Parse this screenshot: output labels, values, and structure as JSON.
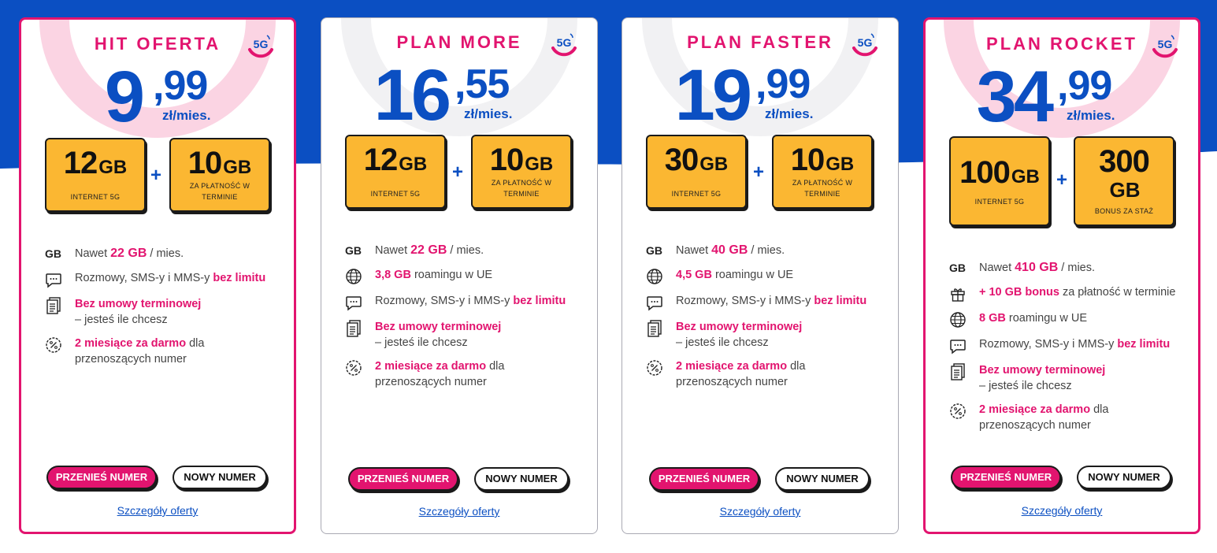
{
  "colors": {
    "accent_pink": "#e2146f",
    "brand_blue": "#0b4fc2",
    "tile_orange": "#fbb732"
  },
  "cards": [
    {
      "title": "HIT OFERTA",
      "price_int": "9",
      "price_dec": "99",
      "price_unit": "zł/mies.",
      "tiles": [
        {
          "num": "12",
          "gb": "GB",
          "desc": "INTERNET 5G"
        },
        {
          "num": "10",
          "gb": "GB",
          "desc": "ZA PŁATNOŚĆ W TERMINIE"
        }
      ],
      "features": {
        "data_a": "Nawet ",
        "data_b": "22 GB",
        "data_c": " / mies.",
        "calls_a": "Rozmowy, SMS-y i MMS-y ",
        "calls_b": "bez limitu",
        "contract_a": "Bez umowy terminowej",
        "contract_b": "– jesteś ile chcesz",
        "promo_a": "2 miesiące za darmo",
        "promo_b": " dla przenoszących numer"
      },
      "btn_primary": "PRZENIEŚ NUMER",
      "btn_secondary": "NOWY NUMER",
      "link": "Szczegóły oferty"
    },
    {
      "title": "PLAN MORE",
      "price_int": "16",
      "price_dec": "55",
      "price_unit": "zł/mies.",
      "tiles": [
        {
          "num": "12",
          "gb": "GB",
          "desc": "INTERNET 5G"
        },
        {
          "num": "10",
          "gb": "GB",
          "desc": "ZA PŁATNOŚĆ W TERMINIE"
        }
      ],
      "features": {
        "data_a": "Nawet ",
        "data_b": "22 GB",
        "data_c": " / mies.",
        "roam_a": "3,8 GB",
        "roam_b": " roamingu w UE",
        "calls_a": "Rozmowy, SMS-y i MMS-y ",
        "calls_b": "bez limitu",
        "contract_a": "Bez umowy terminowej",
        "contract_b": "– jesteś ile chcesz",
        "promo_a": "2 miesiące za darmo",
        "promo_b": " dla przenoszących numer"
      },
      "btn_primary": "PRZENIEŚ NUMER",
      "btn_secondary": "NOWY NUMER",
      "link": "Szczegóły oferty"
    },
    {
      "title": "PLAN FASTER",
      "price_int": "19",
      "price_dec": "99",
      "price_unit": "zł/mies.",
      "tiles": [
        {
          "num": "30",
          "gb": "GB",
          "desc": "INTERNET 5G"
        },
        {
          "num": "10",
          "gb": "GB",
          "desc": "ZA PŁATNOŚĆ W TERMINIE"
        }
      ],
      "features": {
        "data_a": "Nawet ",
        "data_b": "40 GB",
        "data_c": " / mies.",
        "roam_a": "4,5 GB",
        "roam_b": " roamingu w UE",
        "calls_a": "Rozmowy, SMS-y i MMS-y ",
        "calls_b": "bez limitu",
        "contract_a": "Bez umowy terminowej",
        "contract_b": "– jesteś ile chcesz",
        "promo_a": "2 miesiące za darmo",
        "promo_b": " dla przenoszących numer"
      },
      "btn_primary": "PRZENIEŚ NUMER",
      "btn_secondary": "NOWY NUMER",
      "link": "Szczegóły oferty"
    },
    {
      "title": "PLAN ROCKET",
      "price_int": "34",
      "price_dec": "99",
      "price_unit": "zł/mies.",
      "tiles": [
        {
          "num": "100",
          "gb": "GB",
          "desc": "INTERNET 5G"
        },
        {
          "num": "300",
          "gb": "GB",
          "desc": "BONUS ZA STAŻ"
        }
      ],
      "features": {
        "data_a": "Nawet ",
        "data_b": "410 GB",
        "data_c": " / mies.",
        "bonus_a": "+ 10 GB bonus",
        "bonus_b": " za płatność w terminie",
        "roam_a": "8 GB",
        "roam_b": " roamingu w UE",
        "calls_a": "Rozmowy, SMS-y i MMS-y ",
        "calls_b": "bez limitu",
        "contract_a": "Bez umowy terminowej",
        "contract_b": "– jesteś ile chcesz",
        "promo_a": "2 miesiące za darmo",
        "promo_b": " dla przenoszących numer"
      },
      "btn_primary": "PRZENIEŚ NUMER",
      "btn_secondary": "NOWY NUMER",
      "link": "Szczegóły oferty"
    }
  ],
  "icons": {
    "data": "GB",
    "badge": "5G",
    "chat": "chat-bubble-icon",
    "globe": "globe-icon",
    "document": "document-icon",
    "percent": "percent-badge-icon",
    "gift": "gift-icon"
  }
}
